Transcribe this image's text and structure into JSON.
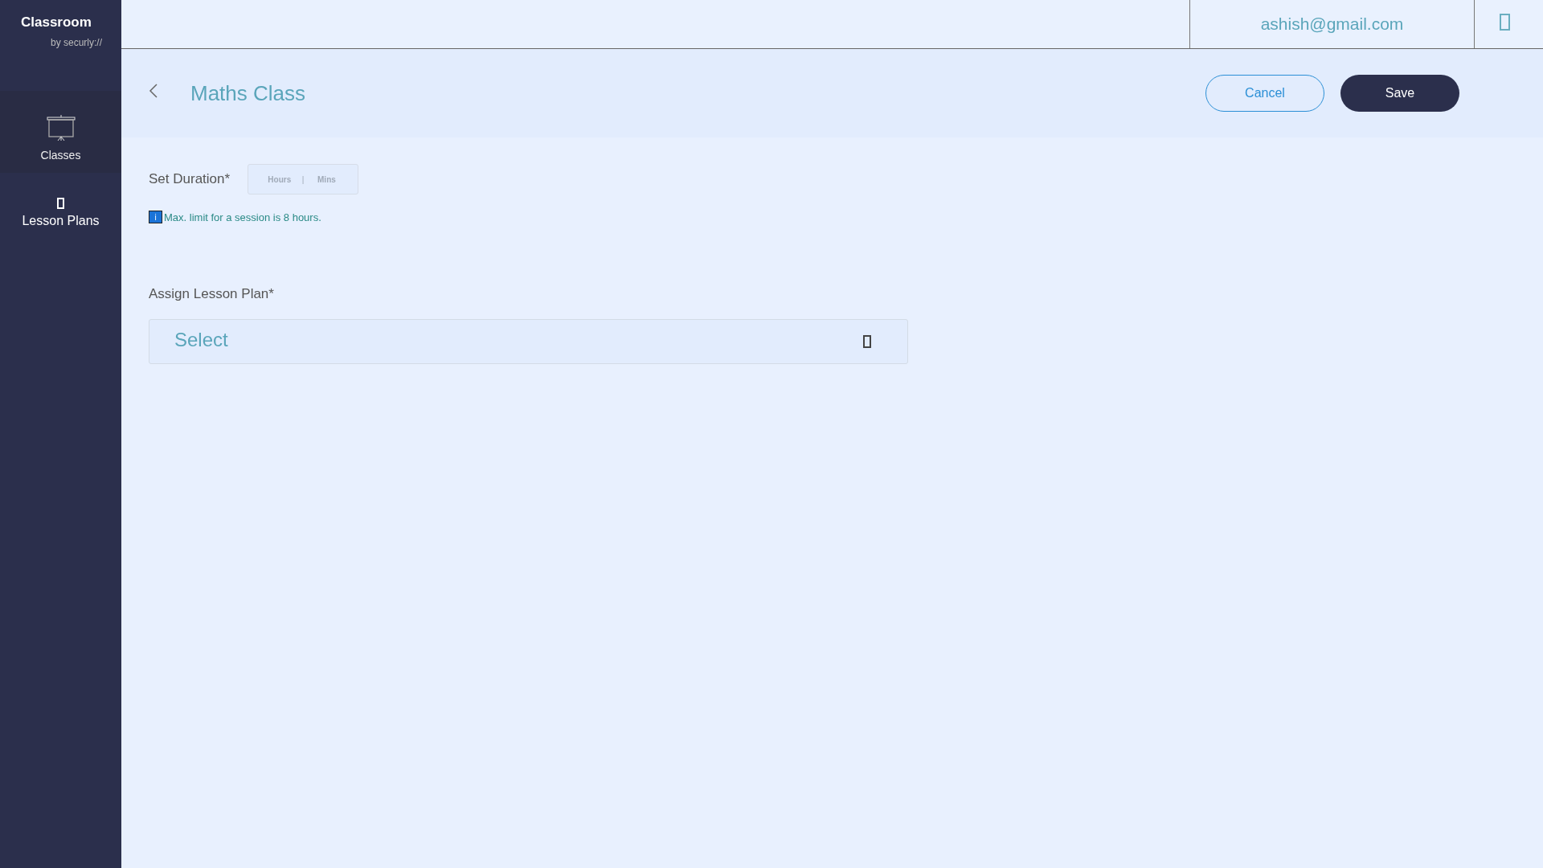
{
  "brand": {
    "title": "Classroom",
    "byline": "by securly://"
  },
  "sidebar": {
    "items": [
      {
        "label": "Classes",
        "kind": "screen",
        "selected": true
      },
      {
        "label": "Lesson Plans",
        "kind": "glyph",
        "selected": false
      }
    ]
  },
  "topbar": {
    "email": "ashish@gmail.com"
  },
  "header": {
    "title": "Maths Class",
    "buttons": [
      {
        "label": "Cancel",
        "kind": "outline"
      },
      {
        "label": "Save",
        "kind": "solid"
      }
    ]
  },
  "duration": {
    "label": "Set Duration*",
    "hours_placeholder": "Hours",
    "separator": "|",
    "mins_placeholder": "Mins",
    "info_icon": "i",
    "note": "Max. limit for a session is 8 hours."
  },
  "lesson_plan": {
    "label": "Assign Lesson Plan*",
    "placeholder": "Select"
  }
}
